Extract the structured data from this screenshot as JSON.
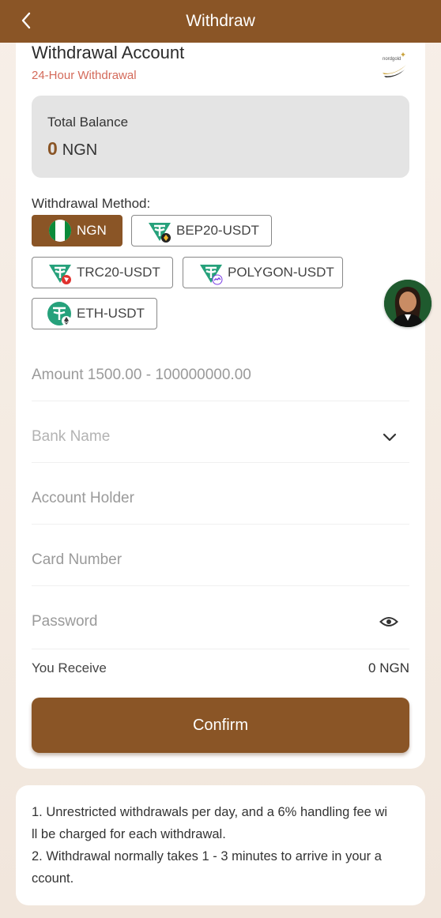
{
  "header": {
    "title": "Withdraw",
    "back_icon": "chevron-left-icon"
  },
  "account": {
    "title": "Withdrawal Account",
    "subtitle": "24-Hour Withdrawal",
    "logo_text": "nordgold"
  },
  "balance": {
    "label": "Total Balance",
    "amount": "0",
    "currency": "NGN"
  },
  "methods": {
    "label": "Withdrawal Method:",
    "items": [
      {
        "label": "NGN",
        "icon": "nigeria-flag-icon",
        "active": true
      },
      {
        "label": "BEP20-USDT",
        "icon": "tether-bnb-icon",
        "active": false
      },
      {
        "label": "TRC20-USDT",
        "icon": "tether-tron-icon",
        "active": false
      },
      {
        "label": "POLYGON-USDT",
        "icon": "tether-polygon-icon",
        "active": false
      },
      {
        "label": "ETH-USDT",
        "icon": "tether-eth-icon",
        "active": false
      }
    ]
  },
  "form": {
    "amount_placeholder": "Amount 1500.00 - 100000000.00",
    "bank_placeholder": "Bank Name",
    "holder_placeholder": "Account Holder",
    "card_placeholder": "Card Number",
    "password_placeholder": "Password"
  },
  "receive": {
    "label": "You Receive",
    "value": "0 NGN"
  },
  "confirm_label": "Confirm",
  "notes": {
    "text": "1. Unrestricted withdrawals per day, and a 6% handling fee wi\nll be charged for each withdrawal.\n2. Withdrawal normally takes 1 - 3 minutes to arrive in your a\nccount."
  },
  "colors": {
    "brand": "#8a5526",
    "subtitle": "#d46a5a",
    "tether": "#26a17b"
  }
}
